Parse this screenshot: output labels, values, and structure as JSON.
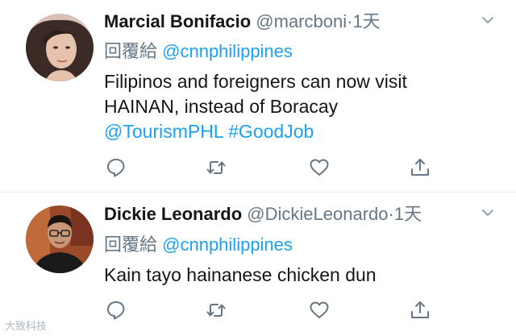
{
  "tweets": [
    {
      "display_name": "Marcial Bonifacio",
      "handle": "@marcboni",
      "time": "1天",
      "reply_prefix": "回覆給",
      "reply_mention": "@cnnphilippines",
      "text_line1": "Filipinos and foreigners can now visit",
      "text_line2": "HAINAN, instead of Boracay",
      "links": [
        "@TourismPHL",
        "#GoodJob"
      ]
    },
    {
      "display_name": "Dickie Leonardo",
      "handle": "@DickieLeonardo",
      "time": "1天",
      "reply_prefix": "回覆給",
      "reply_mention": "@cnnphilippines",
      "text_line1": "Kain tayo hainanese chicken dun"
    }
  ],
  "separator": "·",
  "icons": [
    "reply-icon",
    "retweet-icon",
    "like-icon",
    "share-icon",
    "chevron-down-icon"
  ],
  "watermark": "大致科技",
  "colors": {
    "link": "#1da1f2",
    "muted": "#657786",
    "icon": "#657786"
  }
}
